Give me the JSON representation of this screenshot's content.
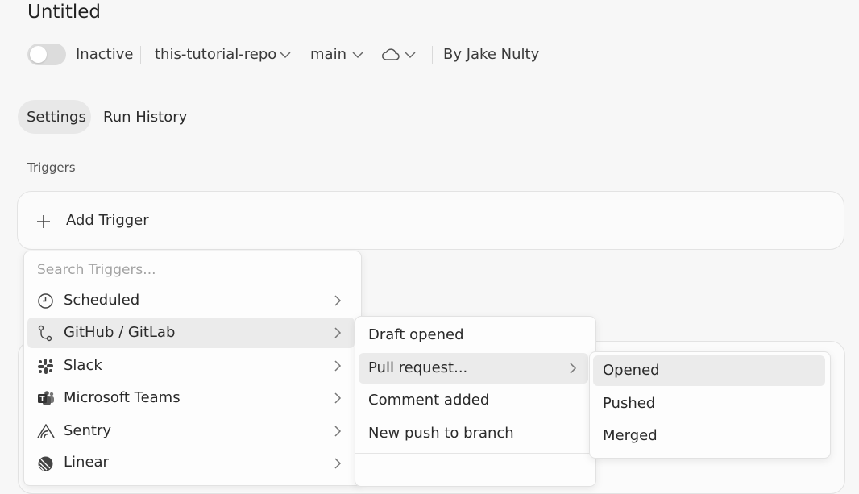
{
  "header": {
    "title": "Untitled",
    "status_label": "Inactive",
    "repo": "this-tutorial-repo",
    "branch": "main",
    "environment_icon": "cloud-icon",
    "author": "By Jake Nulty"
  },
  "tabs": [
    {
      "label": "Settings",
      "selected": true
    },
    {
      "label": "Run History",
      "selected": false
    }
  ],
  "triggers": {
    "section_label": "Triggers",
    "add_label": "Add Trigger",
    "search_placeholder": "Search Triggers...",
    "categories": [
      {
        "label": "Scheduled",
        "icon": "clock-icon"
      },
      {
        "label": "GitHub / GitLab",
        "icon": "git-branch-icon",
        "highlighted": true
      },
      {
        "label": "Slack",
        "icon": "slack-icon"
      },
      {
        "label": "Microsoft Teams",
        "icon": "teams-icon"
      },
      {
        "label": "Sentry",
        "icon": "sentry-icon"
      },
      {
        "label": "Linear",
        "icon": "linear-icon"
      }
    ],
    "github_events": [
      {
        "label": "Draft opened"
      },
      {
        "label": "Pull request...",
        "highlighted": true
      },
      {
        "label": "Comment added"
      },
      {
        "label": "New push to branch"
      }
    ],
    "pull_request_events": [
      {
        "label": "Opened",
        "highlighted": true
      },
      {
        "label": "Pushed"
      },
      {
        "label": "Merged"
      }
    ]
  },
  "colors": {
    "background": "#f7f7f7",
    "highlight": "#ebebeb",
    "toggle_off": "#dcdcdc"
  }
}
